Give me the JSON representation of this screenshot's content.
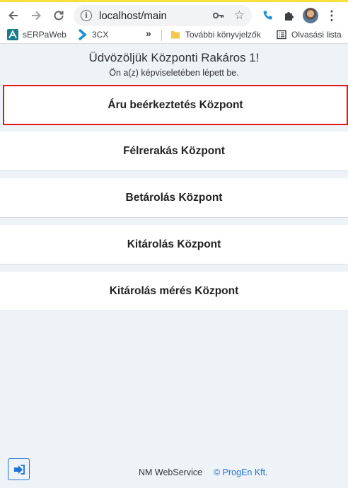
{
  "browser": {
    "url": "localhost/main",
    "bookmarks": [
      {
        "label": "sERPaWeb"
      },
      {
        "label": "3CX"
      },
      {
        "label": "»"
      },
      {
        "label": "További könyvjelzők"
      },
      {
        "label": "Olvasási lista"
      }
    ]
  },
  "app": {
    "welcome": "Üdvözöljük Központi Rakáros 1!",
    "subwelcome": "Ön a(z) képviseletében lépett be.",
    "menu": [
      {
        "label": "Áru beérkeztetés Központ",
        "selected": true
      },
      {
        "label": "Félrerakás Központ",
        "selected": false
      },
      {
        "label": "Betárolás Központ",
        "selected": false
      },
      {
        "label": "Kitárolás Központ",
        "selected": false
      },
      {
        "label": "Kitárolás mérés Központ",
        "selected": false
      }
    ],
    "footer": {
      "service": "NM WebService",
      "company": "© ProgEn Kft."
    },
    "colors": {
      "selected_border": "#e01818",
      "accent": "#1d73d6",
      "background": "#eef3f8"
    }
  }
}
